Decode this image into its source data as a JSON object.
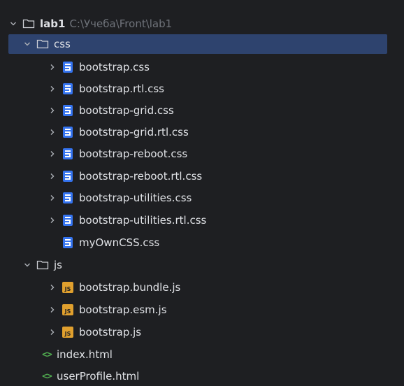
{
  "project": {
    "name": "lab1",
    "path": "C:\\Учеба\\Front\\lab1"
  },
  "folders": {
    "css": "css",
    "js": "js"
  },
  "css_files": [
    "bootstrap.css",
    "bootstrap.rtl.css",
    "bootstrap-grid.css",
    "bootstrap-grid.rtl.css",
    "bootstrap-reboot.css",
    "bootstrap-reboot.rtl.css",
    "bootstrap-utilities.css",
    "bootstrap-utilities.rtl.css",
    "myOwnCSS.css"
  ],
  "js_files": [
    "bootstrap.bundle.js",
    "bootstrap.esm.js",
    "bootstrap.js"
  ],
  "html_files": [
    "index.html",
    "userProfile.html"
  ],
  "icons": {
    "js_badge": "JS",
    "html_badge": "<>"
  },
  "colors": {
    "background": "#1e1f22",
    "selection": "#2e436e",
    "text": "#dfe1e5",
    "path_hint": "#6f737a",
    "css_icon": "#3574f0",
    "js_icon": "#e0a02e",
    "html_icon": "#4fa84f"
  }
}
